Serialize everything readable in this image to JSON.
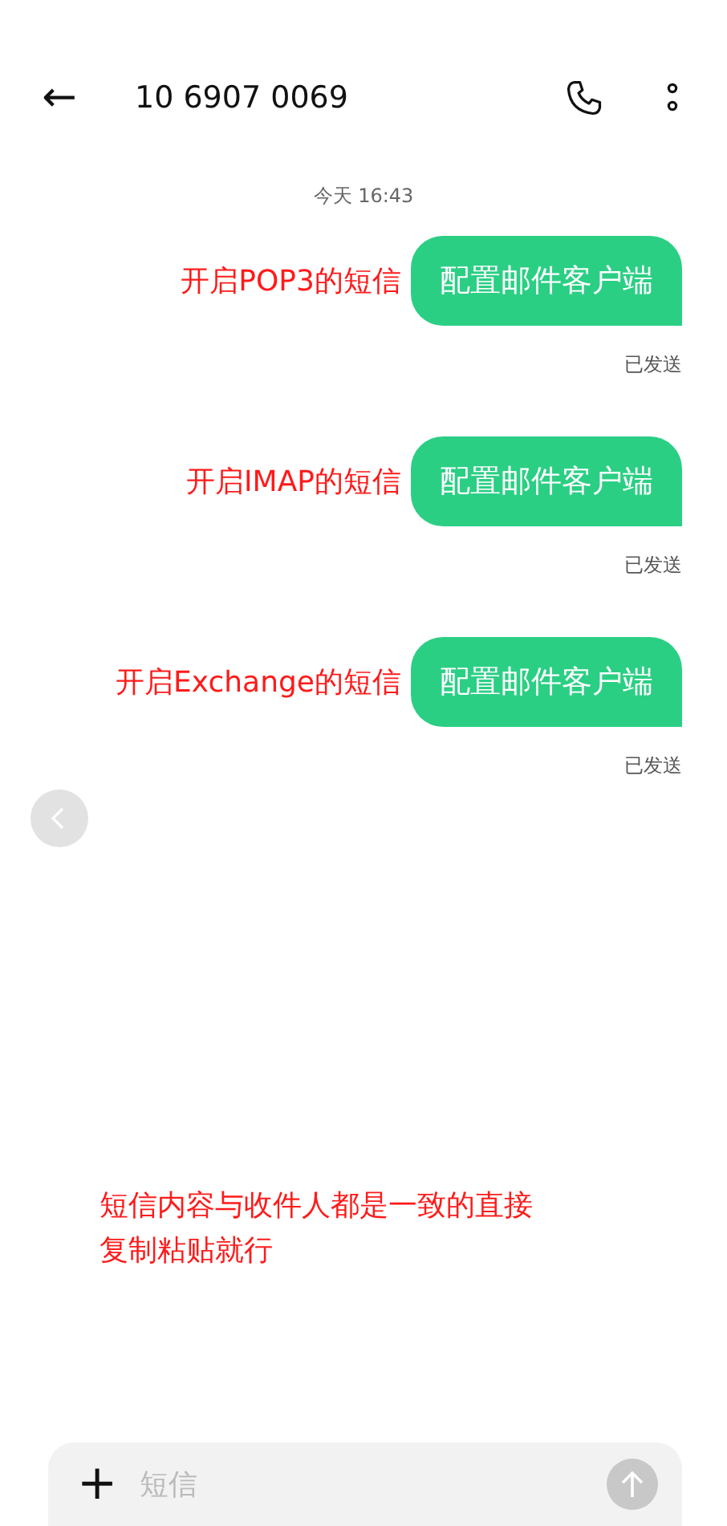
{
  "header": {
    "back": "←",
    "title": "10 6907 0069"
  },
  "timestamp": "今天 16:43",
  "messages": [
    {
      "text": "配置邮件客户端",
      "status": "已发送",
      "note": "开启POP3的短信"
    },
    {
      "text": "配置邮件客户端",
      "status": "已发送",
      "note": "开启IMAP的短信"
    },
    {
      "text": "配置邮件客户端",
      "status": "已发送",
      "note": "开启Exchange的短信"
    }
  ],
  "bottom_note": [
    "短信内容与收件人都是一致的直接",
    "复制粘贴就行"
  ],
  "composer": {
    "add": "+",
    "placeholder": "短信"
  }
}
